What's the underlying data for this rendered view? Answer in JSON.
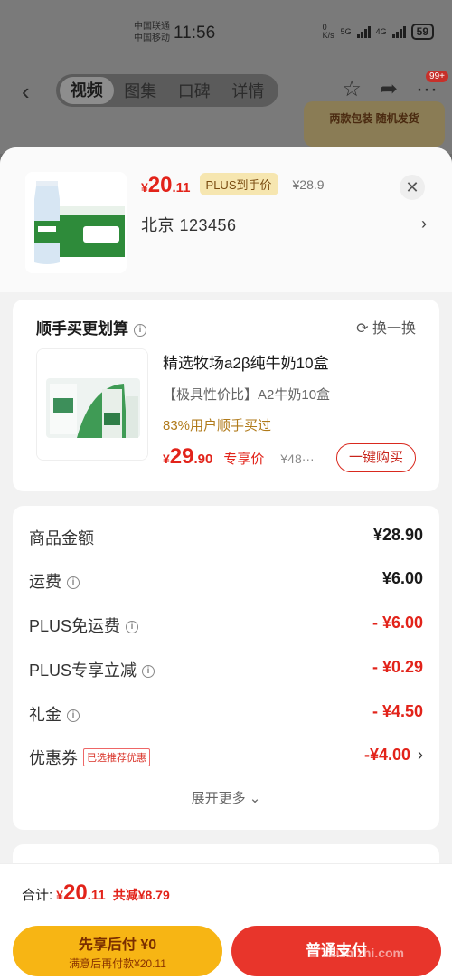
{
  "status_bar": {
    "carrier1": "中国联通",
    "carrier2": "中国移动",
    "time": "11:56",
    "speed": "0 K/s",
    "net1": "5G",
    "net2": "4G",
    "battery": "59"
  },
  "nav": {
    "tabs": [
      {
        "label": "视频",
        "active": true
      },
      {
        "label": "图集",
        "active": false
      },
      {
        "label": "口碑",
        "active": false
      },
      {
        "label": "详情",
        "active": false
      }
    ],
    "badge": "99+"
  },
  "promo_banner": "两款包装 随机发货",
  "product": {
    "price_currency": "¥",
    "price_int": "20",
    "price_dec": ".11",
    "plus_tag": "PLUS到手价",
    "original_price": "¥28.9",
    "address": "北京  123456"
  },
  "bundle": {
    "title": "顺手买更划算",
    "refresh_label": "换一换",
    "name": "精选牧场a2β纯牛奶10盒",
    "subtitle": "【极具性价比】A2牛奶10盒",
    "stat": "83%用户顺手买过",
    "price_currency": "¥",
    "price_int": "29",
    "price_dec": ".90",
    "exclusive_label": "专享价",
    "original_price": "¥48···",
    "buy_label": "一键购买"
  },
  "totals": {
    "rows": [
      {
        "label": "商品金额",
        "value": "¥28.90",
        "info": false
      },
      {
        "label": "运费",
        "value": "¥6.00",
        "info": true
      },
      {
        "label": "PLUS免运费",
        "value": "- ¥6.00",
        "info": true
      },
      {
        "label": "PLUS专享立减",
        "value": "- ¥0.29",
        "info": true
      },
      {
        "label": "礼金",
        "value": "- ¥4.50",
        "info": true
      },
      {
        "label": "优惠券",
        "value": "-¥4.00",
        "tag": "已选推荐优惠"
      }
    ],
    "expand_label": "展开更多"
  },
  "bottom": {
    "sum_label": "合计:",
    "sum_currency": "¥",
    "sum_int": "20",
    "sum_dec": ".11",
    "saved": "共减¥8.79",
    "pay_later_line1": "先享后付 ¥0",
    "pay_later_line2": "满意后再付款¥20.11",
    "pay_normal": "普通支付"
  },
  "watermark": "zhizhizhi.com",
  "colors": {
    "accent_red": "#e2231a",
    "pay_later_yellow": "#f7b514",
    "plus_gold": "#f6e6b0"
  }
}
